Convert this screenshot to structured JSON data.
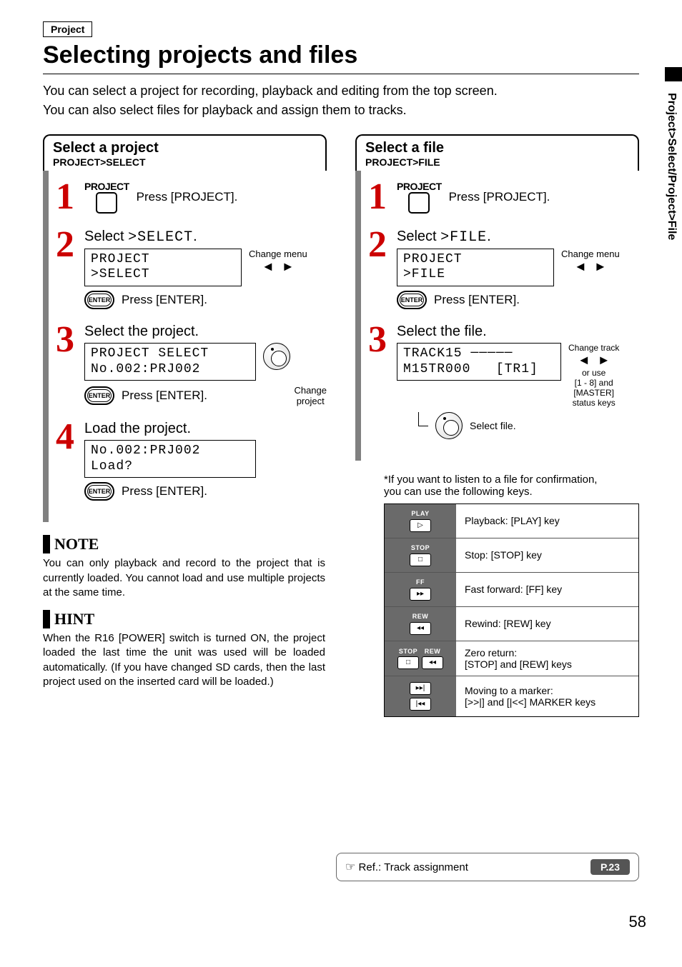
{
  "top_tag": "Project",
  "title": "Selecting projects and files",
  "intro": {
    "line1": "You can select a project for recording, playback and editing from the top screen.",
    "line2": "You can also select files for playback and assign them to tracks."
  },
  "side_tab": "Project>Select/Project>File",
  "left_panel": {
    "head_title": "Select a project",
    "head_bc": "PROJECT>SELECT",
    "step1": {
      "label": "PROJECT",
      "text": "Press [PROJECT]."
    },
    "step2": {
      "title_pre": "Select ",
      "title_mono": ">SELECT",
      "title_post": ".",
      "lcd_l1": "PROJECT",
      "lcd_l2": ">SELECT",
      "change": "Change menu",
      "press": "Press [ENTER]."
    },
    "step3": {
      "title": "Select the project.",
      "lcd_l1": "PROJECT  SELECT",
      "lcd_l2": "No.002:PRJ002",
      "press": "Press [ENTER].",
      "change_l1": "Change",
      "change_l2": "project"
    },
    "step4": {
      "title": "Load the project.",
      "lcd_l1": "No.002:PRJ002",
      "lcd_l2": "Load?",
      "press": "Press [ENTER]."
    }
  },
  "right_panel": {
    "head_title": "Select a file",
    "head_bc": "PROJECT>FILE",
    "step1": {
      "label": "PROJECT",
      "text": "Press [PROJECT]."
    },
    "step2": {
      "title_pre": "Select ",
      "title_mono": ">FILE",
      "title_post": ".",
      "lcd_l1": "PROJECT",
      "lcd_l2": ">FILE",
      "change": "Change menu",
      "press": "Press [ENTER]."
    },
    "step3": {
      "title": "Select the file.",
      "lcd_l1": "TRACK15",
      "lcd_l2": "M15TR000",
      "lcd_tr": "[TR1]",
      "change_track": "Change track",
      "or_use_l1": "or use",
      "or_use_l2": "[1 - 8] and",
      "or_use_l3": "[MASTER]",
      "or_use_l4": "status keys",
      "select_file": "Select file."
    },
    "confirm_note_l1": "*If you want to listen to a file for confirmation,",
    "confirm_note_l2": "you can use the following keys.",
    "keys": [
      {
        "labels": [
          "PLAY"
        ],
        "glyphs": [
          "▷"
        ],
        "desc": "Playback: [PLAY] key"
      },
      {
        "labels": [
          "STOP"
        ],
        "glyphs": [
          "□"
        ],
        "desc": "Stop: [STOP] key"
      },
      {
        "labels": [
          "FF"
        ],
        "glyphs": [
          "▸▸"
        ],
        "desc": "Fast forward: [FF] key"
      },
      {
        "labels": [
          "REW"
        ],
        "glyphs": [
          "◂◂"
        ],
        "desc": "Rewind: [REW] key"
      },
      {
        "labels": [
          "STOP",
          "REW"
        ],
        "glyphs": [
          "□",
          "◂◂"
        ],
        "desc": "Zero return:",
        "desc2": "[STOP] and [REW] keys"
      },
      {
        "labels": [
          "",
          ""
        ],
        "glyphs": [
          "▸▸|",
          "|◂◂"
        ],
        "stack": true,
        "desc": "Moving to a marker:",
        "desc2": "[>>|] and [|<<] MARKER keys"
      }
    ]
  },
  "note": {
    "title": "NOTE",
    "body": "You can only playback and record to the project that is currently loaded. You cannot load and use multiple projects at the same time."
  },
  "hint": {
    "title": "HINT",
    "body": "When the R16 [POWER] switch is turned ON, the project loaded the last time the unit was used will be loaded automatically. (If you have changed SD cards, then the last project used on the inserted card will be loaded.)"
  },
  "footer": {
    "ref": "Ref.: Track assignment",
    "badge": "P.23"
  },
  "page_number": "58"
}
